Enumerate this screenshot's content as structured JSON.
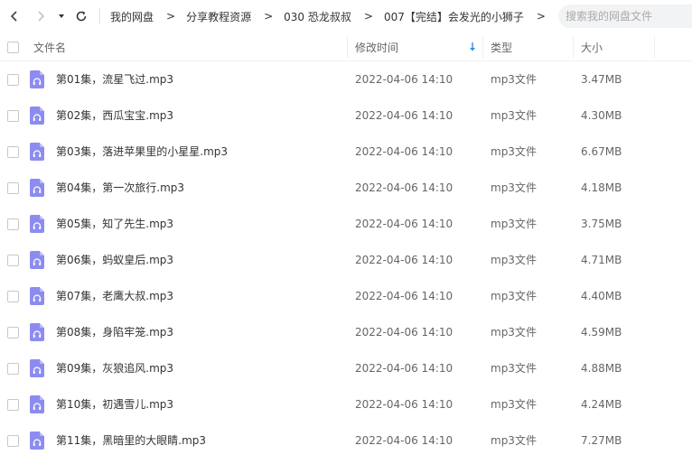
{
  "toolbar": {
    "back_icon": "chevron-left-icon",
    "forward_icon": "chevron-right-icon",
    "history_icon": "caret-down-icon",
    "refresh_icon": "refresh-icon"
  },
  "breadcrumb": [
    "我的网盘",
    "分享教程资源",
    "030 恐龙叔叔",
    "007【完结】会发光的小狮子"
  ],
  "breadcrumb_separator": ">",
  "search": {
    "placeholder": "搜索我的网盘文件"
  },
  "columns": {
    "name": "文件名",
    "modified": "修改时间",
    "type": "类型",
    "size": "大小"
  },
  "colors": {
    "audio_icon": "#8c8cf0",
    "sort_arrow": "#2e8cf0"
  },
  "files": [
    {
      "name": "第01集，流星飞过.mp3",
      "modified": "2022-04-06 14:10",
      "type": "mp3文件",
      "size": "3.47MB"
    },
    {
      "name": "第02集，西瓜宝宝.mp3",
      "modified": "2022-04-06 14:10",
      "type": "mp3文件",
      "size": "4.30MB"
    },
    {
      "name": "第03集，落进苹果里的小星星.mp3",
      "modified": "2022-04-06 14:10",
      "type": "mp3文件",
      "size": "6.67MB"
    },
    {
      "name": "第04集，第一次旅行.mp3",
      "modified": "2022-04-06 14:10",
      "type": "mp3文件",
      "size": "4.18MB"
    },
    {
      "name": "第05集，知了先生.mp3",
      "modified": "2022-04-06 14:10",
      "type": "mp3文件",
      "size": "3.75MB"
    },
    {
      "name": "第06集，蚂蚁皇后.mp3",
      "modified": "2022-04-06 14:10",
      "type": "mp3文件",
      "size": "4.71MB"
    },
    {
      "name": "第07集，老鹰大叔.mp3",
      "modified": "2022-04-06 14:10",
      "type": "mp3文件",
      "size": "4.40MB"
    },
    {
      "name": "第08集，身陷牢笼.mp3",
      "modified": "2022-04-06 14:10",
      "type": "mp3文件",
      "size": "4.59MB"
    },
    {
      "name": "第09集，灰狼追风.mp3",
      "modified": "2022-04-06 14:10",
      "type": "mp3文件",
      "size": "4.88MB"
    },
    {
      "name": "第10集，初遇雪儿.mp3",
      "modified": "2022-04-06 14:10",
      "type": "mp3文件",
      "size": "4.24MB"
    },
    {
      "name": "第11集，黑暗里的大眼睛.mp3",
      "modified": "2022-04-06 14:10",
      "type": "mp3文件",
      "size": "7.27MB"
    }
  ]
}
